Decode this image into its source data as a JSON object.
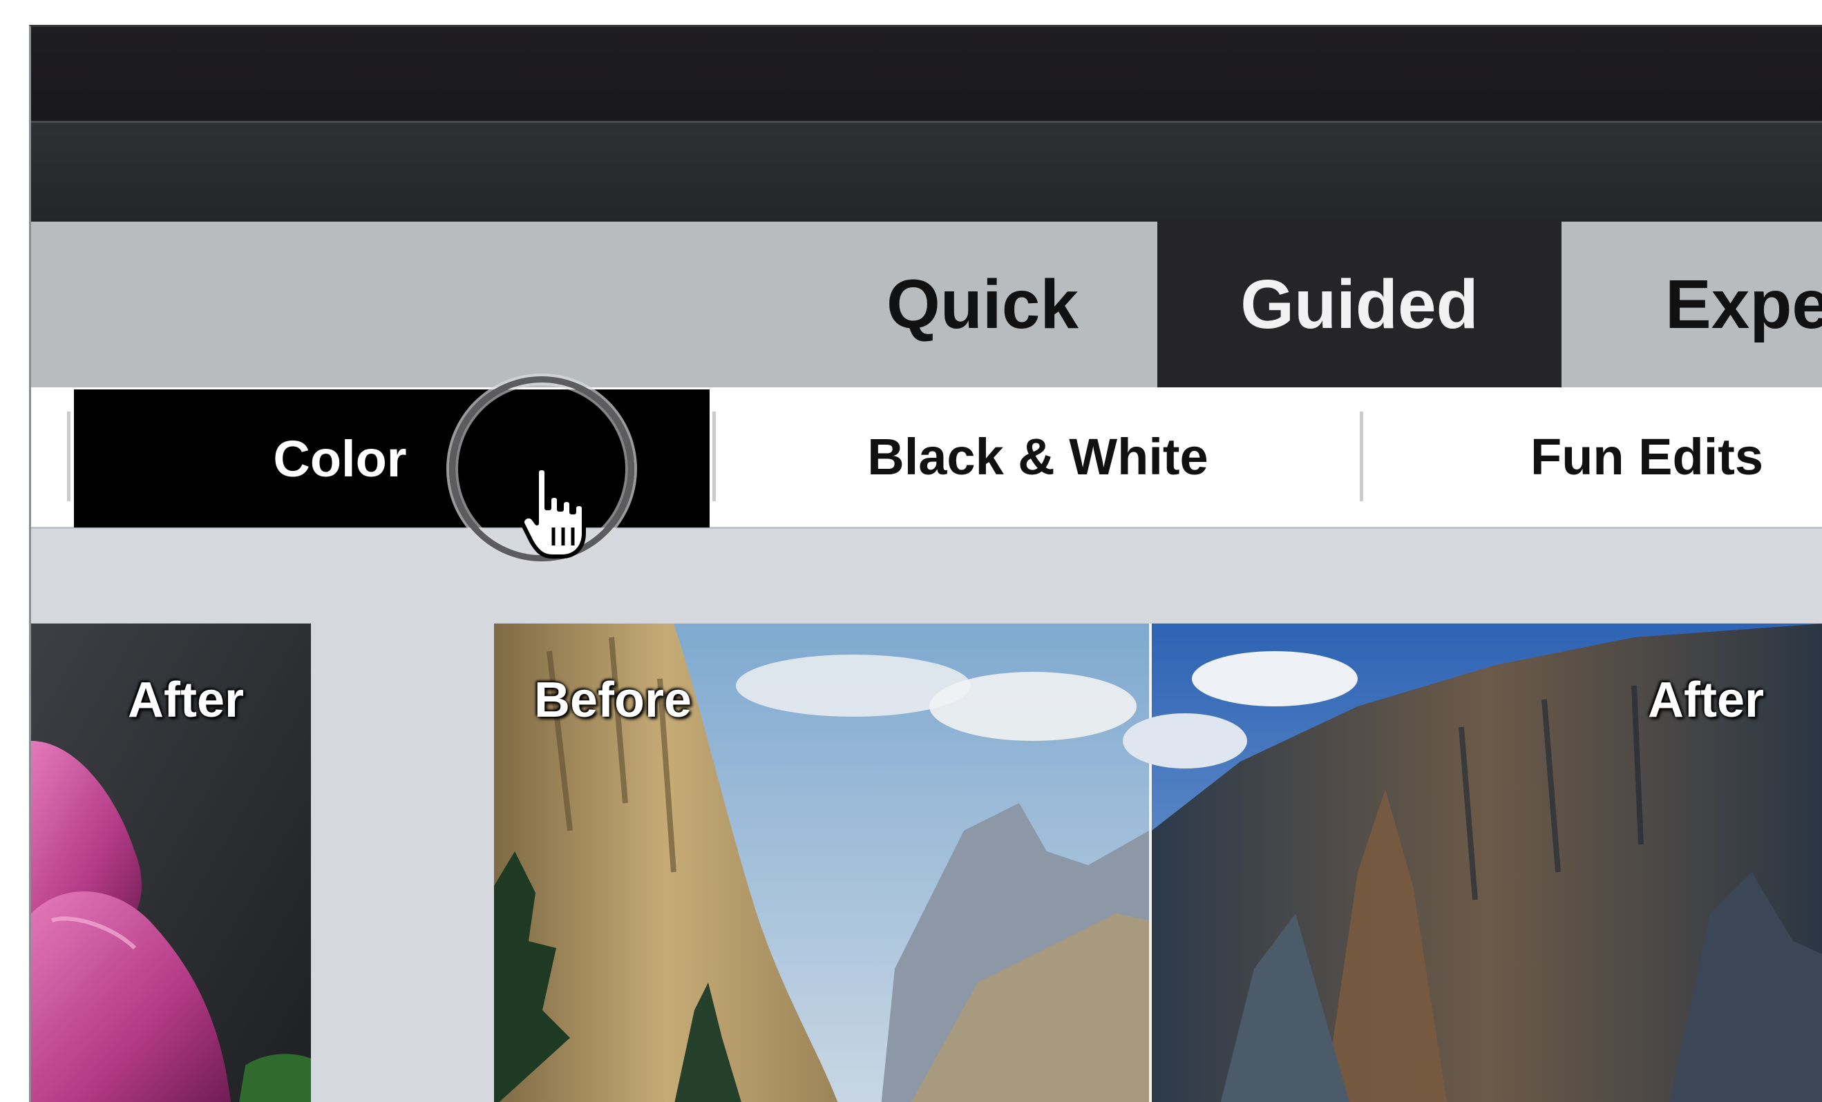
{
  "mode_tabs": [
    {
      "label": "Quick",
      "active": false
    },
    {
      "label": "Guided",
      "active": true
    },
    {
      "label": "Exper",
      "active": false
    }
  ],
  "categories": [
    {
      "label": "Color",
      "active": true
    },
    {
      "label": "Black & White",
      "active": false
    },
    {
      "label": "Fun Edits",
      "active": false
    }
  ],
  "thumbnails": {
    "tulip": {
      "after_label": "After"
    },
    "yosemite": {
      "before_label": "Before",
      "after_label": "After"
    }
  },
  "colors": {
    "menubar": "#1e1d1f",
    "modebar": "#b9bcbf",
    "active_mode_tab": "#252527",
    "active_category": "#000000",
    "content_background": "#d5d8dc"
  }
}
